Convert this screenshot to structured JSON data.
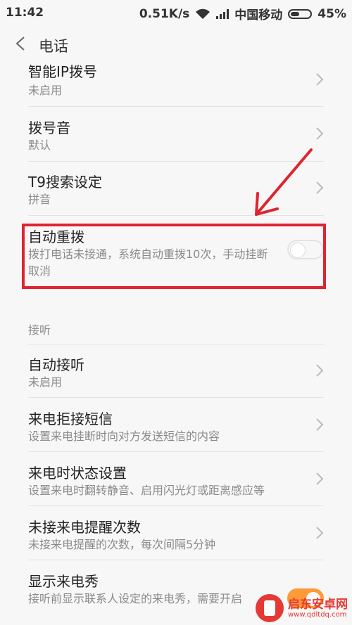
{
  "status_bar": {
    "time": "11:42",
    "speed": "0.51K/s",
    "carrier": "中国移动",
    "battery": "45%",
    "battery_level": 0.45
  },
  "header": {
    "title": "电话"
  },
  "rows": [
    {
      "title": "智能IP拨号",
      "subtitle": "未启用"
    },
    {
      "title": "拨号音",
      "subtitle": "默认"
    },
    {
      "title": "T9搜索设定",
      "subtitle": "拼音"
    },
    {
      "title": "自动重拨",
      "subtitle": "拨打电话未接通，系统自动重拨10次，手动挂断取消",
      "toggle": false
    },
    {
      "title": "自动接听",
      "subtitle": "未启用"
    },
    {
      "title": "来电拒接短信",
      "subtitle": "设置来电挂断时向对方发送短信的内容"
    },
    {
      "title": "来电时状态设置",
      "subtitle": "设置来电时翻转静音、启用闪光灯或距离感应等"
    },
    {
      "title": "未接来电提醒次数",
      "subtitle": "未接来电提醒的次数，每次间隔5分钟"
    },
    {
      "title": "显示来电秀",
      "subtitle": "接听前显示联系人设定的来电秀，需要开启",
      "toggle": true
    }
  ],
  "section_label": "接听",
  "annotation": {
    "color": "#e0242f"
  },
  "watermark": {
    "name": "启东安卓网",
    "url": "www.qdltdq.com"
  },
  "colors": {
    "accent": "#ff9a36",
    "text": "#222222",
    "subtext": "#8a8a8a"
  }
}
